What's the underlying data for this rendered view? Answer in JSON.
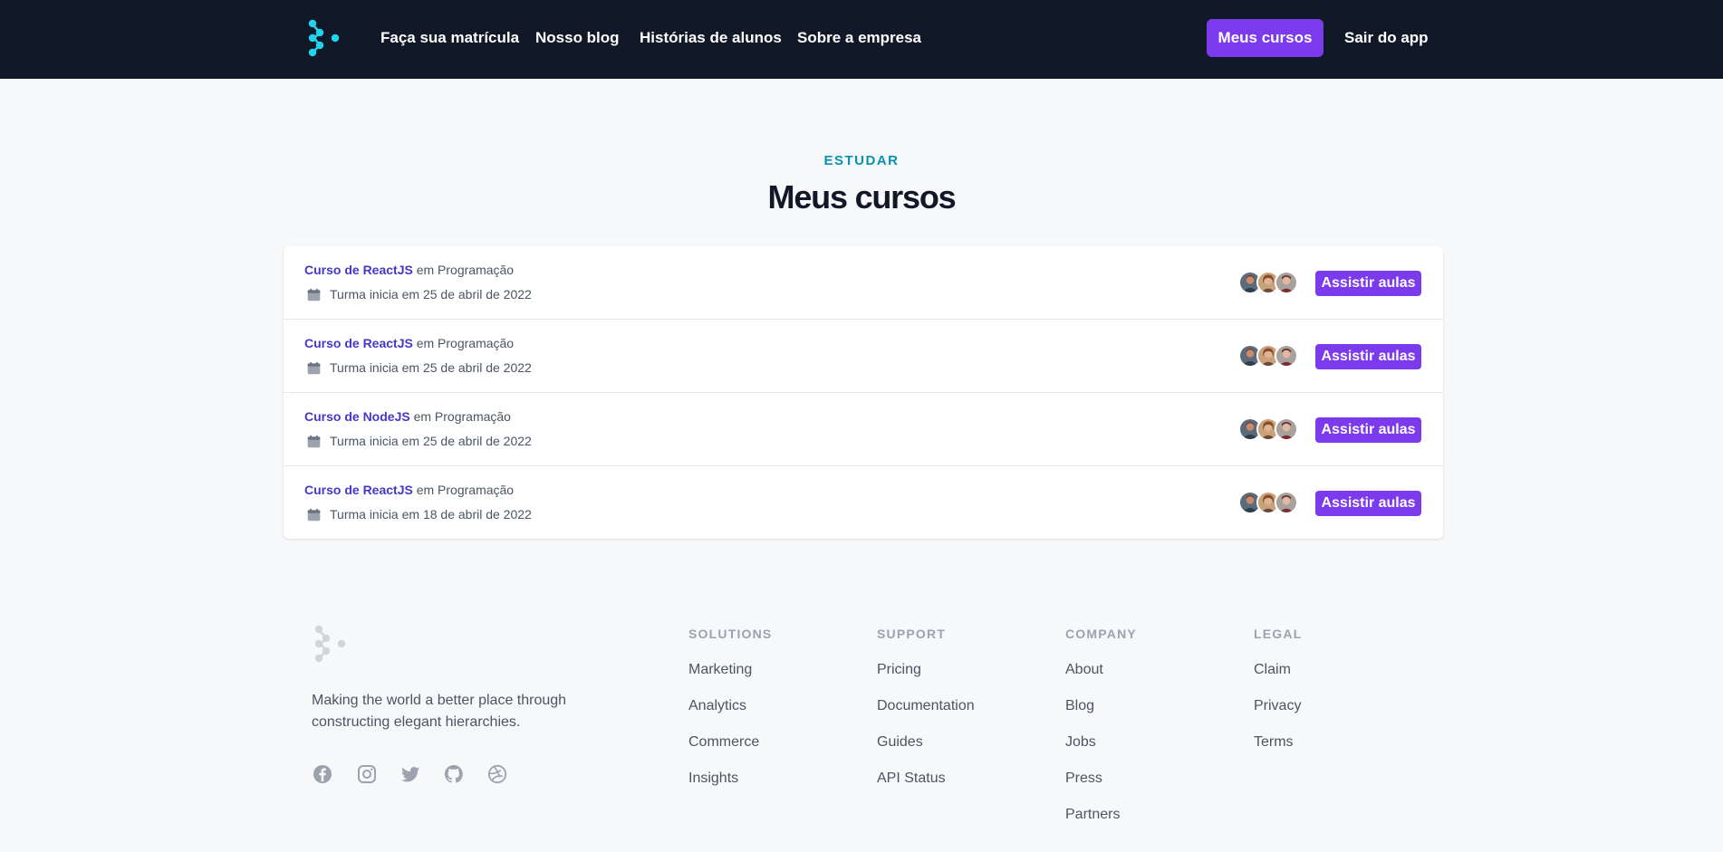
{
  "colors": {
    "header_bg": "#111827",
    "brand_accent": "#7c3aed",
    "logo_teal": "#22d3ee",
    "eyebrow": "#0891b2",
    "course_link": "#4338ca"
  },
  "header": {
    "logo_icon": "brand-logo-icon",
    "nav": [
      {
        "label": "Faça sua matrícula"
      },
      {
        "label": "Nosso blog"
      },
      {
        "label": "Histórias de alunos"
      },
      {
        "label": "Sobre a empresa"
      }
    ],
    "primary_button": "Meus cursos",
    "logout_button": "Sair do app"
  },
  "main": {
    "eyebrow": "ESTUDAR",
    "title": "Meus cursos",
    "courses": [
      {
        "name": "Curso de ReactJS",
        "category": "em Programação",
        "start": "Turma inicia em 25 de abril de 2022",
        "action": "Assistir aulas"
      },
      {
        "name": "Curso de ReactJS",
        "category": "em Programação",
        "start": "Turma inicia em 25 de abril de 2022",
        "action": "Assistir aulas"
      },
      {
        "name": "Curso de NodeJS",
        "category": "em Programação",
        "start": "Turma inicia em 25 de abril de 2022",
        "action": "Assistir aulas"
      },
      {
        "name": "Curso de ReactJS",
        "category": "em Programação",
        "start": "Turma inicia em 18 de abril de 2022",
        "action": "Assistir aulas"
      }
    ]
  },
  "footer": {
    "tagline": "Making the world a better place through constructing elegant hierarchies.",
    "social_icons": [
      "facebook-icon",
      "instagram-icon",
      "twitter-icon",
      "github-icon",
      "dribbble-icon"
    ],
    "columns": [
      {
        "heading": "SOLUTIONS",
        "links": [
          "Marketing",
          "Analytics",
          "Commerce",
          "Insights"
        ]
      },
      {
        "heading": "SUPPORT",
        "links": [
          "Pricing",
          "Documentation",
          "Guides",
          "API Status"
        ]
      },
      {
        "heading": "COMPANY",
        "links": [
          "About",
          "Blog",
          "Jobs",
          "Press",
          "Partners"
        ]
      },
      {
        "heading": "LEGAL",
        "links": [
          "Claim",
          "Privacy",
          "Terms"
        ]
      }
    ]
  }
}
